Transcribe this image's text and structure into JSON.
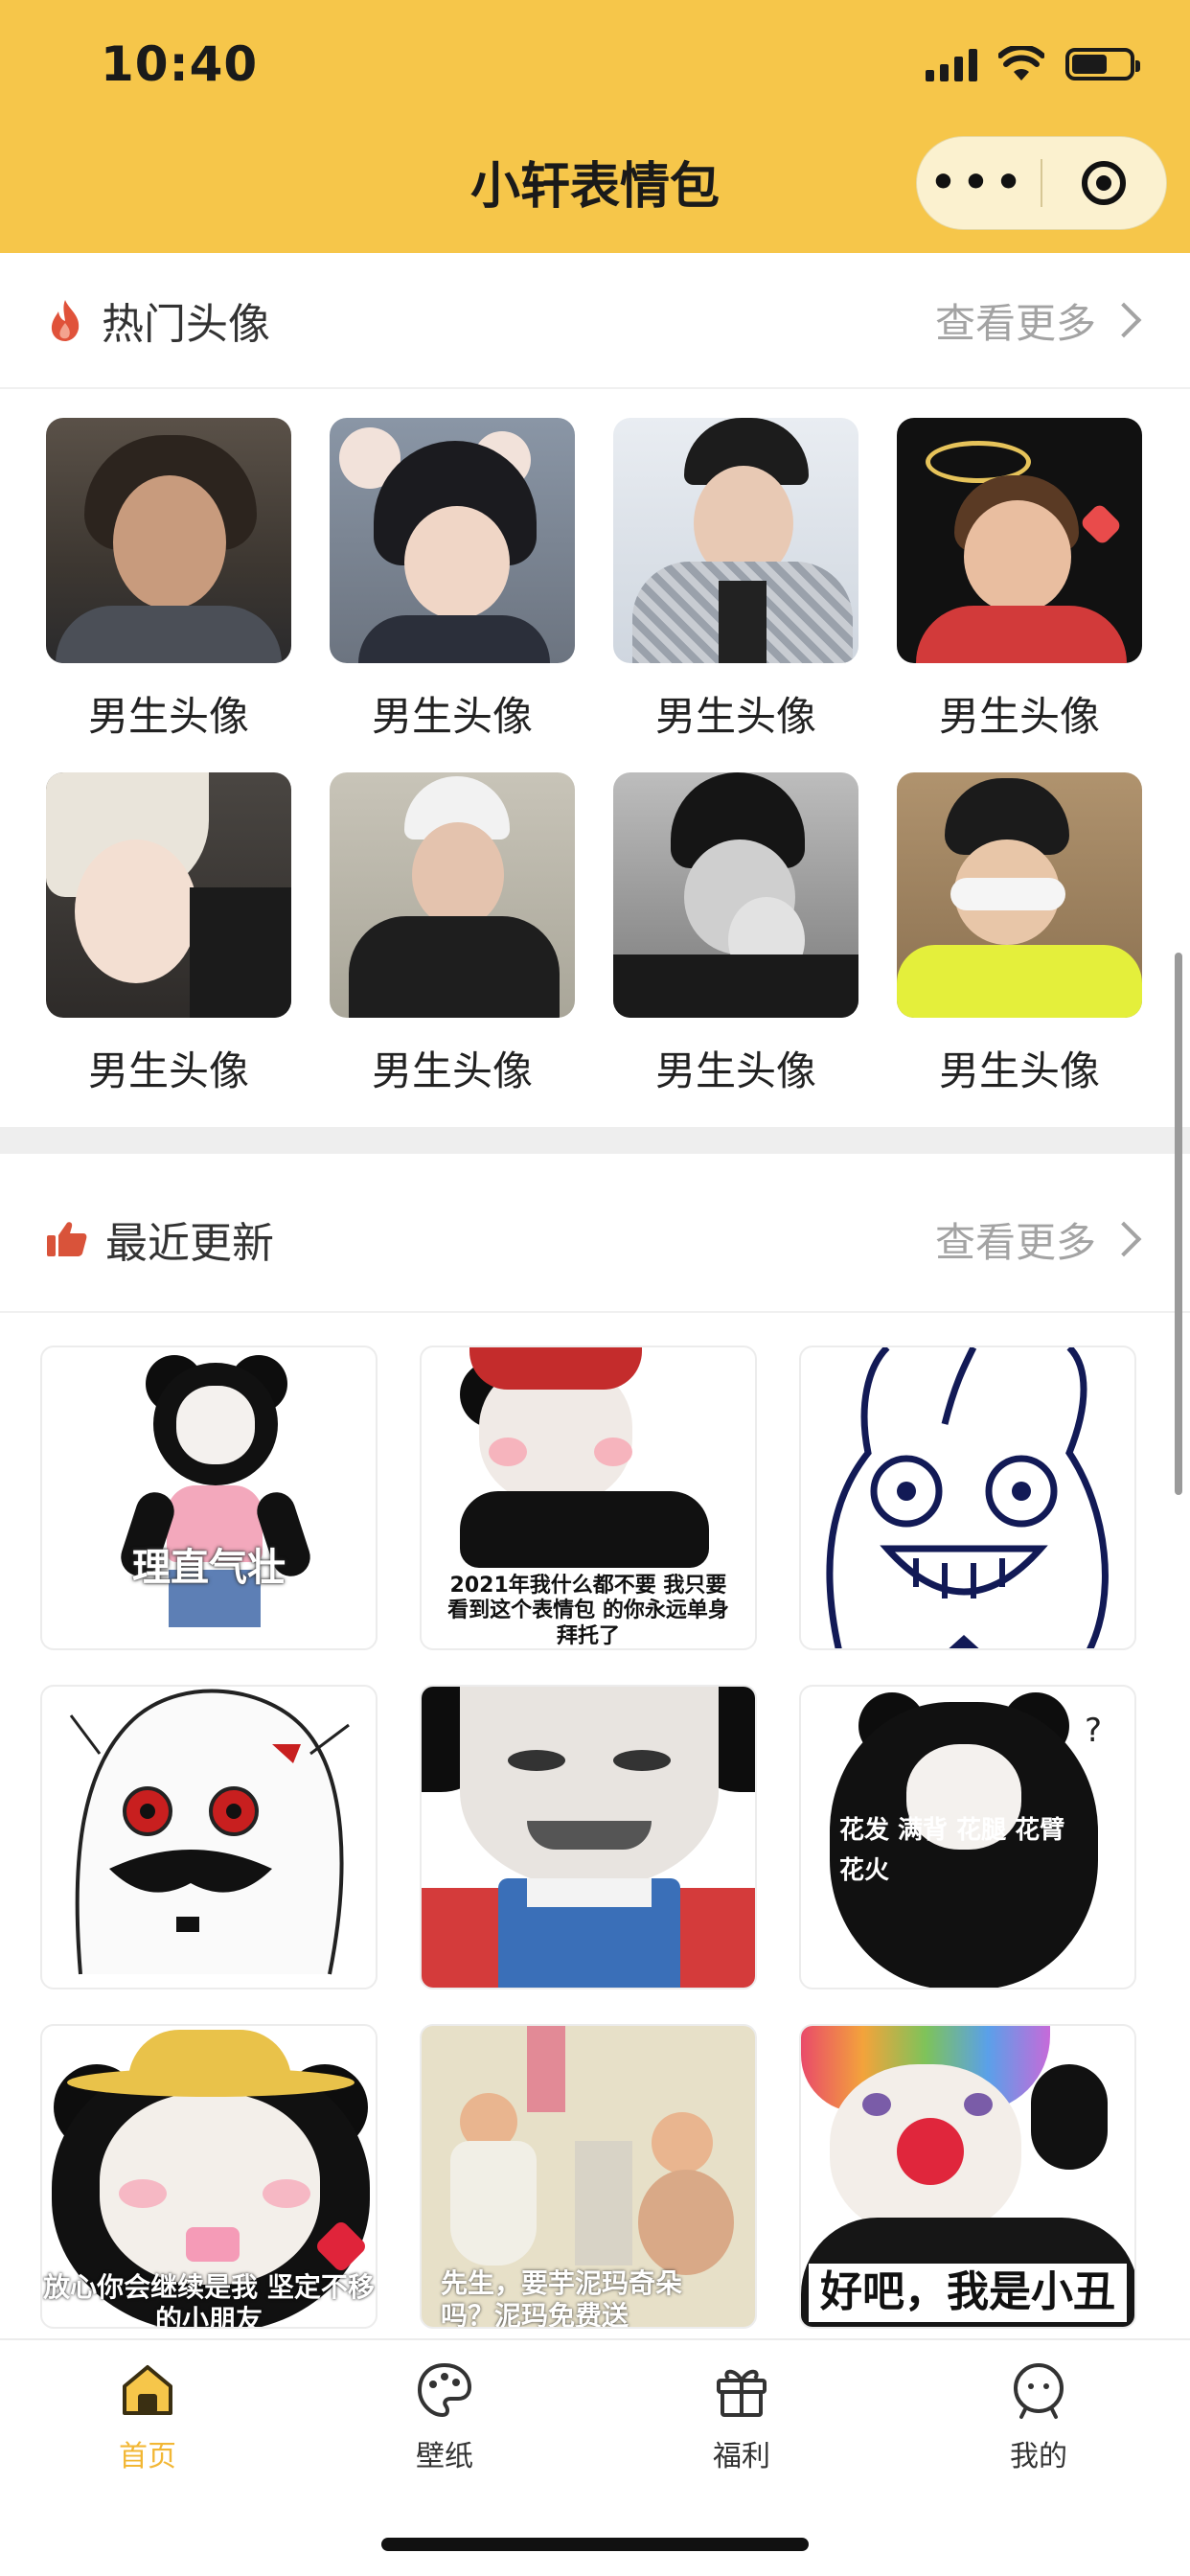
{
  "status_bar": {
    "time": "10:40"
  },
  "nav": {
    "title": "小轩表情包",
    "more_glyph": "•••"
  },
  "hot_avatars": {
    "title": "热门头像",
    "more_label": "查看更多",
    "items": [
      {
        "label": "男生头像"
      },
      {
        "label": "男生头像"
      },
      {
        "label": "男生头像"
      },
      {
        "label": "男生头像"
      },
      {
        "label": "男生头像"
      },
      {
        "label": "男生头像"
      },
      {
        "label": "男生头像"
      },
      {
        "label": "男生头像"
      }
    ]
  },
  "recent": {
    "title": "最近更新",
    "more_label": "查看更多",
    "stickers": [
      {
        "caption": "理直气壮"
      },
      {
        "caption": "2021年我什么都不要 我只要看到这个表情包 的你永远单身 拜托了"
      },
      {
        "caption": ""
      },
      {
        "caption": ""
      },
      {
        "caption": ""
      },
      {
        "caption": "花发 满背 花腿 花臂 花火"
      },
      {
        "caption": "放心你会继续是我 坚定不移的小朋友"
      },
      {
        "caption": "先生，要芋泥玛奇朵 吗？泥玛免费送"
      },
      {
        "caption": "好吧，我是小丑"
      }
    ]
  },
  "tabbar": {
    "tabs": [
      {
        "label": "首页",
        "icon": "home-icon",
        "active": true
      },
      {
        "label": "壁纸",
        "icon": "palette-icon",
        "active": false
      },
      {
        "label": "福利",
        "icon": "gift-icon",
        "active": false
      },
      {
        "label": "我的",
        "icon": "user-icon",
        "active": false
      }
    ]
  },
  "colors": {
    "brand": "#f6c64a",
    "active_tab": "#f2b735",
    "flame": "#e0523a",
    "thumb": "#d9533a"
  }
}
